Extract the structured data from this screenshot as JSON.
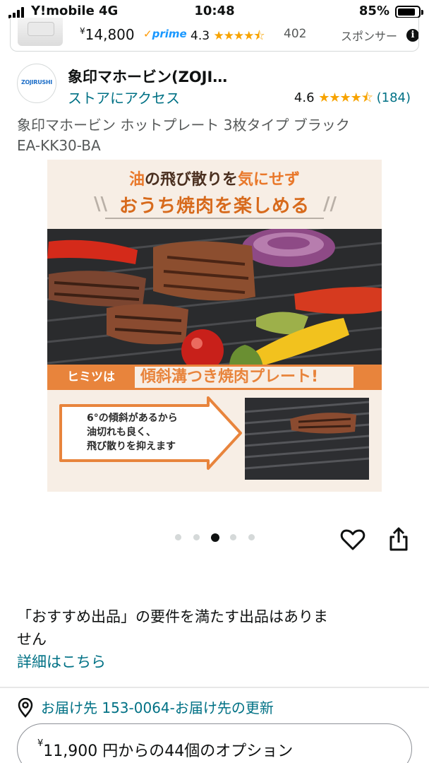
{
  "status_bar": {
    "carrier": "Y!mobile",
    "network": "4G",
    "time": "10:48",
    "battery": "85%",
    "battery_level": 0.85
  },
  "sponsored": {
    "currency": "¥",
    "price": "14,800",
    "prime_label": "prime",
    "rating": "4.3",
    "stars": "★★★★⯪",
    "review_count": "402",
    "label": "スポンサー",
    "info_icon": "info-icon"
  },
  "brand": {
    "logo_text": "ZOJIRUSHI",
    "name": "象印マホービン(ZOJI…",
    "store_link": "ストアにアクセス",
    "rating": "4.6",
    "stars": "★★★★⯪",
    "rating_count": "(184)"
  },
  "product": {
    "title_line1": "象印マホービン ホットプレート 3枚タイプ ブラック",
    "title_line2": "EA-KK30-BA"
  },
  "product_image": {
    "headline1_a": "油",
    "headline1_b": "の飛び散りを",
    "headline1_c": "気にせず",
    "headline2": "おうち焼肉を楽しめる",
    "banner_left": "ヒミツは",
    "banner_right": "傾斜溝つき焼肉プレート!",
    "arrow_line1": "6°の傾斜があるから",
    "arrow_line2": "油切れも良く、",
    "arrow_line3": "飛び散りを抑えます"
  },
  "carousel": {
    "dot_count": 5,
    "active_index": 2
  },
  "actions": {
    "favorite_icon": "heart-icon",
    "share_icon": "share-icon"
  },
  "notice": {
    "text_line1": "「おすすめ出品」の要件を満たす出品はありま",
    "text_line2": "せん",
    "details_link": "詳細はこちら"
  },
  "delivery": {
    "text": "お届け先 153-0064-お届け先の更新"
  },
  "options": {
    "currency": "¥",
    "text": "11,900 円からの44個のオプション"
  },
  "colors": {
    "link": "#007185",
    "star": "#f7a300",
    "prime": "#1a98ff",
    "banner_orange": "#e8843c"
  }
}
